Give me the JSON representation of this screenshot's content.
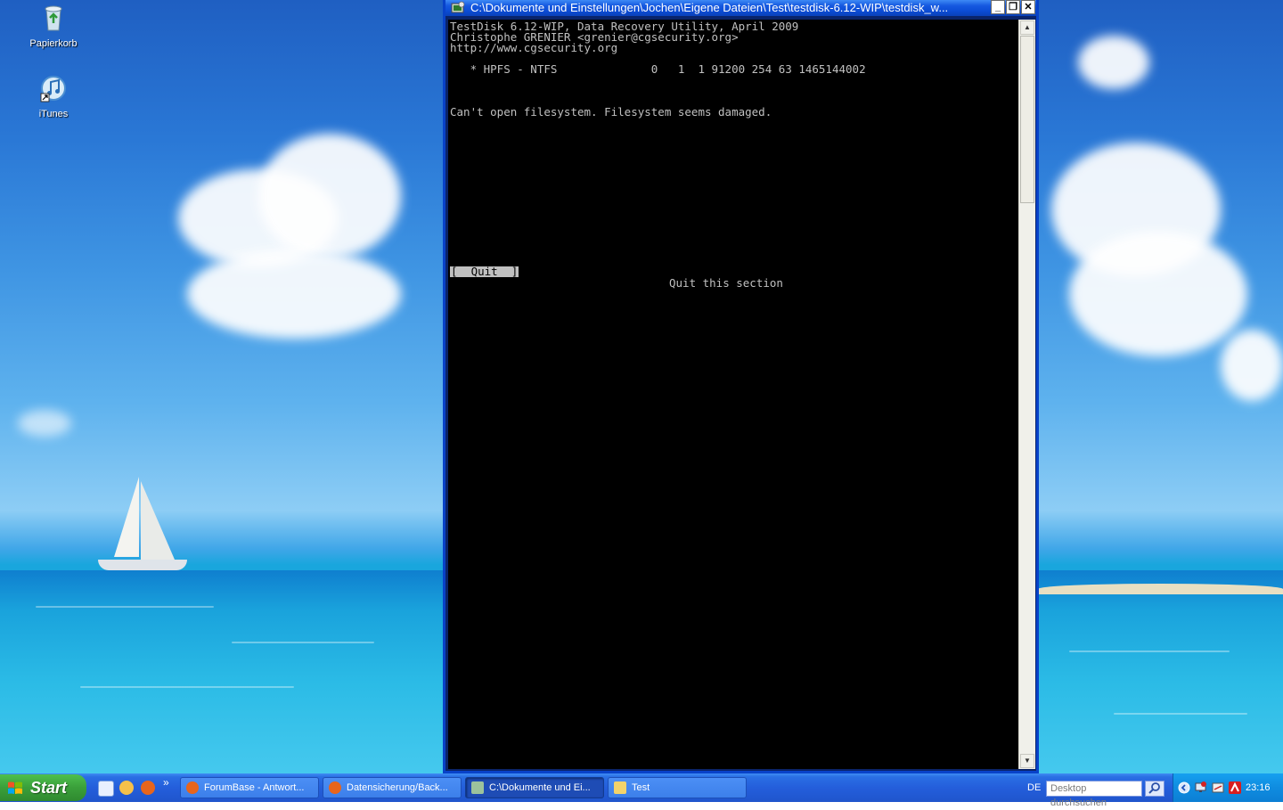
{
  "desktop": {
    "icons": [
      {
        "label": "Papierkorb"
      },
      {
        "label": "iTunes"
      }
    ]
  },
  "console": {
    "title": "C:\\Dokumente und Einstellungen\\Jochen\\Eigene Dateien\\Test\\testdisk-6.12-WIP\\testdisk_w...",
    "lines": [
      "TestDisk 6.12-WIP, Data Recovery Utility, April 2009",
      "Christophe GRENIER <grenier@cgsecurity.org>",
      "http://www.cgsecurity.org",
      "   * HPFS - NTFS              0   1  1 91200 254 63 1465144002",
      "Can't open filesystem. Filesystem seems damaged."
    ],
    "quit_label": "[  Quit  ]",
    "quit_hint": "Quit this section",
    "buttons": {
      "minimize": "_",
      "restore": "❐",
      "close": "✕"
    }
  },
  "taskbar": {
    "start_label": "Start",
    "tasks": [
      {
        "label": "ForumBase - Antwort..."
      },
      {
        "label": "Datensicherung/Back..."
      },
      {
        "label": "C:\\Dokumente und Ei..."
      },
      {
        "label": "Test"
      }
    ],
    "quicklaunch_more": "»",
    "language": "DE",
    "search_placeholder": "Desktop durchsuchen",
    "clock": "23:16"
  },
  "colors": {
    "titlebar": "#0b4bd4",
    "taskbar": "#245edb",
    "start": "#3a9f3a",
    "tray": "#0f8ce0",
    "console_bg": "#000000",
    "console_fg": "#c0c0c0"
  }
}
